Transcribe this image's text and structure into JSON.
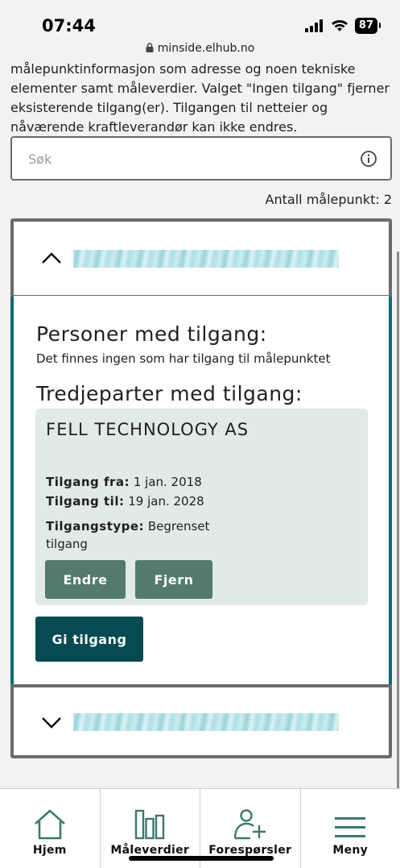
{
  "status_bar": {
    "time": "07:44",
    "battery": "87"
  },
  "url": "minside.elhub.no",
  "intro_text": "målepunktinformasjon som adresse og noen tekniske elementer samt måleverdier. Valget \"Ingen tilgang\" fjerner eksisterende tilgang(er). Tilgangen til netteier og nåværende kraftleverandør kan ikke endres.",
  "search": {
    "placeholder": "Søk",
    "value": ""
  },
  "meter_count": "Antall målepunkt: 2",
  "panel": {
    "persons_heading": "Personer med tilgang:",
    "persons_empty": "Det finnes ingen som har tilgang til målepunktet",
    "third_party_heading": "Tredjeparter med tilgang:",
    "third_party": {
      "name": "FELL TECHNOLOGY AS",
      "from_label": "Tilgang fra:",
      "from_value": "1 jan. 2018",
      "to_label": "Tilgang til:",
      "to_value": "19 jan. 2028",
      "type_label": "Tilgangstype:",
      "type_value": "Begrenset tilgang",
      "edit_button": "Endre",
      "remove_button": "Fjern"
    },
    "give_access_button": "Gi tilgang"
  },
  "bottom_nav": {
    "items": [
      {
        "label": "Hjem",
        "icon": "home-icon"
      },
      {
        "label": "Måleverdier",
        "icon": "bar-chart-icon"
      },
      {
        "label": "Forespørsler",
        "icon": "add-person-icon"
      },
      {
        "label": "Meny",
        "icon": "menu-icon"
      }
    ]
  },
  "colors": {
    "teal_dark": "#074a52",
    "teal_accent": "#0a6b73",
    "button_green": "#527a6e",
    "card_bg": "#e1eae5",
    "nav_icon": "#3b7a6c"
  }
}
